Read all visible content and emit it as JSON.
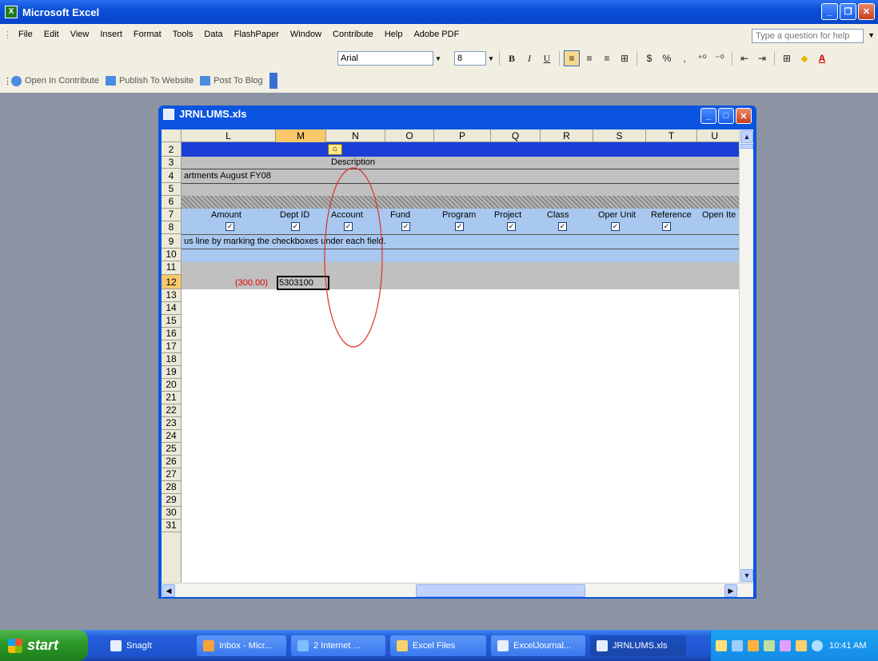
{
  "app": {
    "title": "Microsoft Excel"
  },
  "menu": [
    "File",
    "Edit",
    "View",
    "Insert",
    "Format",
    "Tools",
    "Data",
    "FlashPaper",
    "Window",
    "Contribute",
    "Help",
    "Adobe PDF"
  ],
  "ask_placeholder": "Type a question for help",
  "format_toolbar": {
    "font": "Arial",
    "size": "8",
    "bold": "B",
    "italic": "I",
    "underline": "U",
    "currency": "$",
    "percent": "%",
    "comma": ","
  },
  "contribute_toolbar": {
    "open": "Open In Contribute",
    "publish": "Publish To Website",
    "post": "Post To Blog"
  },
  "workbook": {
    "title": "JRNLUMS.xls",
    "columns": [
      "L",
      "M",
      "N",
      "O",
      "P",
      "Q",
      "R",
      "S",
      "T",
      "U"
    ],
    "selected_column": "M",
    "rows": [
      "2",
      "3",
      "4",
      "5",
      "6",
      "7",
      "8",
      "9",
      "10",
      "11",
      "12",
      "13",
      "14",
      "15",
      "16",
      "17",
      "18",
      "19",
      "20",
      "21",
      "22",
      "23",
      "24",
      "25",
      "26",
      "27",
      "28",
      "29",
      "30",
      "31"
    ],
    "selected_row": "12",
    "description_label": "Description",
    "row4_text": "artments August FY08",
    "field_headers": [
      "Amount",
      "Dept ID",
      "Account",
      "Fund",
      "Program",
      "Project",
      "Class",
      "Oper Unit",
      "Reference",
      "Open Ite"
    ],
    "checkmark": "✓",
    "instruction": "us line by marking the checkboxes under each field.",
    "amount_value": "(300.00)",
    "dept_value": "5303100"
  },
  "taskbar": {
    "start": "start",
    "items": [
      "SnagIt",
      "Inbox - Micr...",
      "2 Internet ...",
      "Excel Files",
      "ExcelJournal...",
      "JRNLUMS.xls"
    ],
    "clock": "10:41 AM"
  },
  "colors": {
    "header_blue": "#1a3fd6",
    "light_blue": "#a9c8ef",
    "gray_band": "#c0c0c0",
    "error_red": "#e00000",
    "annotation": "#e0302a"
  }
}
